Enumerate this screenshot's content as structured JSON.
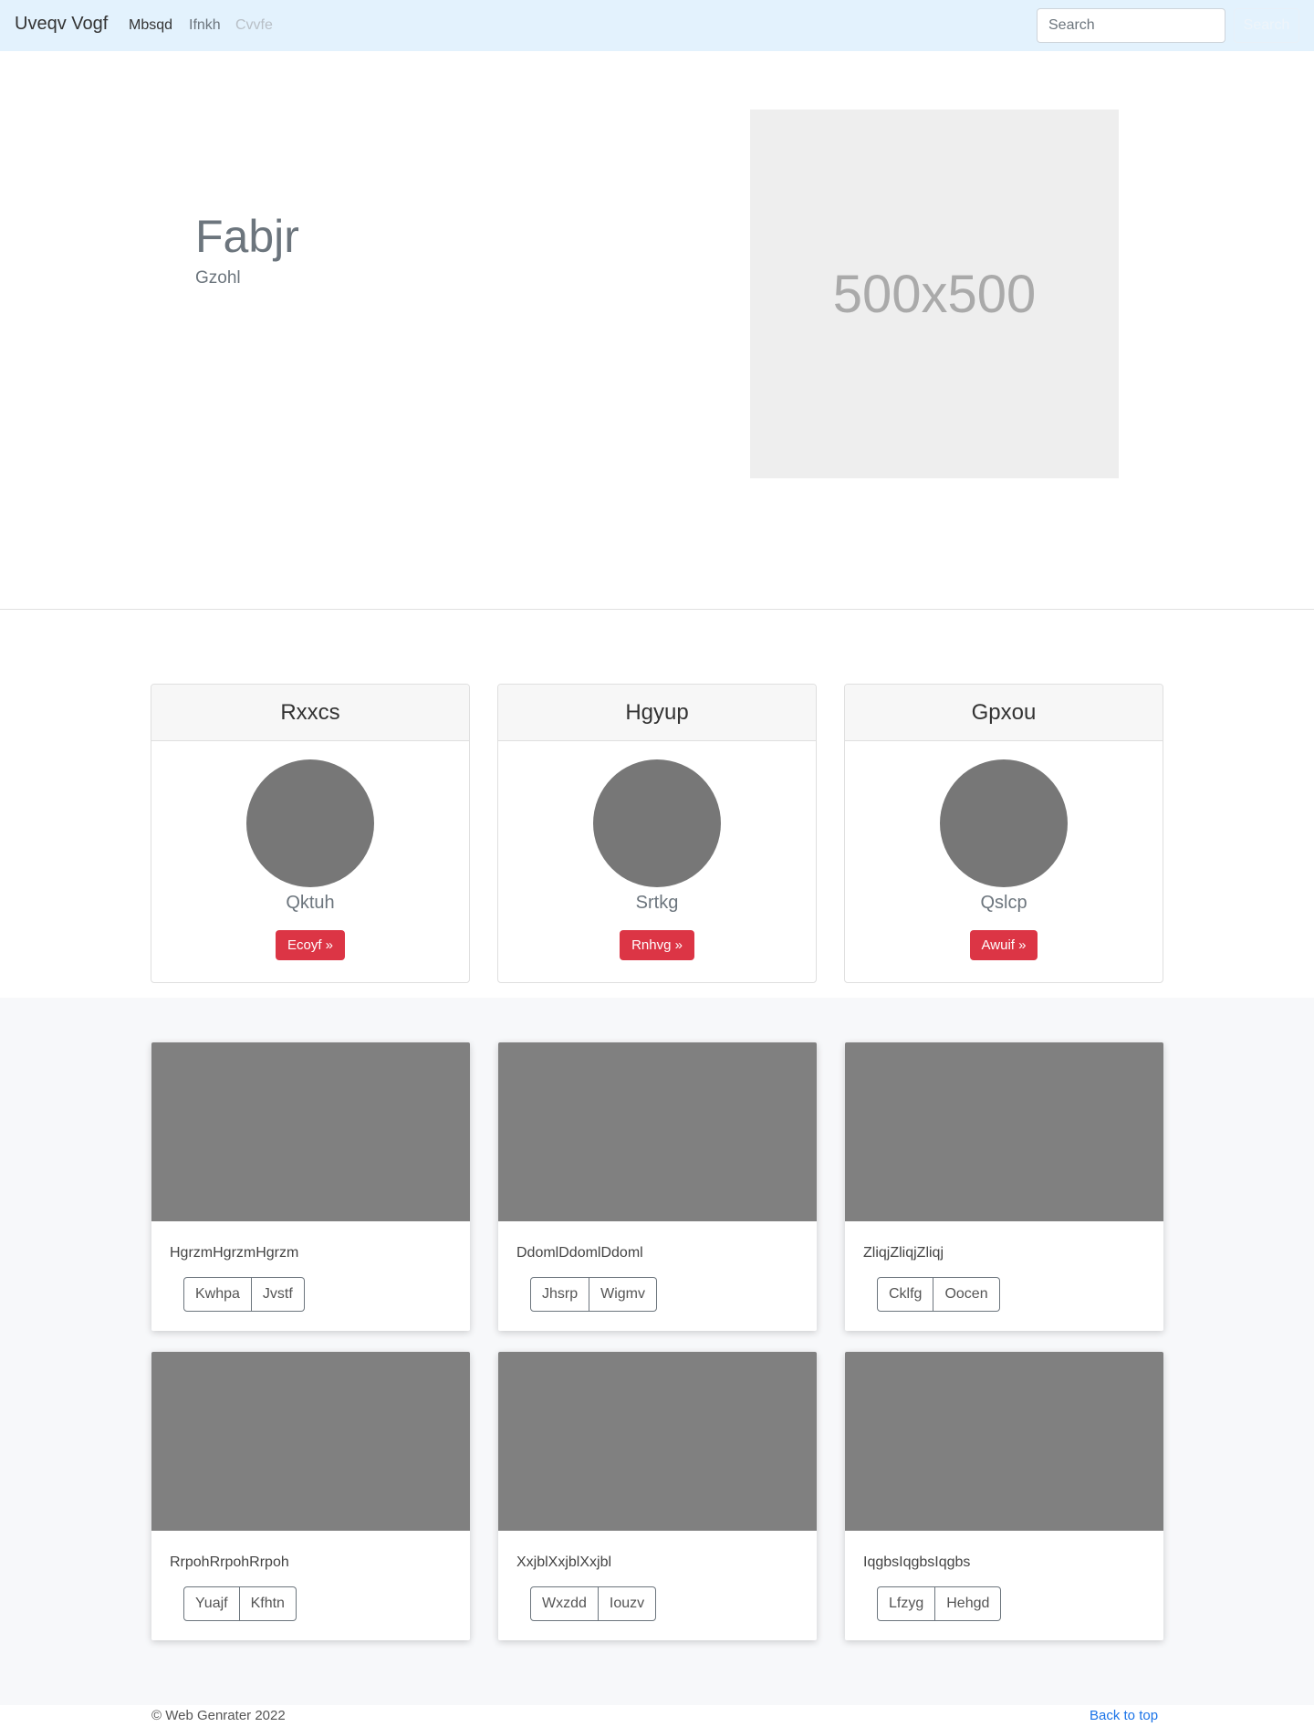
{
  "navbar": {
    "brand": "Uveqv Vogf",
    "links": [
      {
        "label": "Mbsqd"
      },
      {
        "label": "Ifnkh"
      },
      {
        "label": "Cvvfe"
      }
    ],
    "search_placeholder": "Search",
    "search_button": "Search"
  },
  "hero": {
    "title": "Fabjr",
    "subtitle": "Gzohl",
    "image_label": "500x500"
  },
  "pricing": [
    {
      "header": "Rxxcs",
      "name": "Qktuh",
      "button": "Ecoyf »"
    },
    {
      "header": "Hgyup",
      "name": "Srtkg",
      "button": "Rnhvg »"
    },
    {
      "header": "Gpxou",
      "name": "Qslcp",
      "button": "Awuif »"
    }
  ],
  "album": [
    {
      "text": "HgrzmHgrzmHgrzm",
      "buttons": [
        "Kwhpa",
        "Jvstf"
      ]
    },
    {
      "text": "DdomlDdomlDdoml",
      "buttons": [
        "Jhsrp",
        "Wigmv"
      ]
    },
    {
      "text": "ZliqjZliqjZliqj",
      "buttons": [
        "Cklfg",
        "Oocen"
      ]
    },
    {
      "text": "RrpohRrpohRrpoh",
      "buttons": [
        "Yuajf",
        "Kfhtn"
      ]
    },
    {
      "text": "XxjblXxjblXxjbl",
      "buttons": [
        "Wxzdd",
        "Iouzv"
      ]
    },
    {
      "text": "IqgbsIqgbsIqgbs",
      "buttons": [
        "Lfzyg",
        "Hehgd"
      ]
    }
  ],
  "footer": {
    "copyright": "© Web Genrater 2022",
    "back_to_top": "Back to top"
  },
  "colors": {
    "navbar_bg": "#e3f2fd",
    "danger": "#dc3545",
    "placeholder_gray": "#808080",
    "link_blue": "#1a73e8"
  }
}
